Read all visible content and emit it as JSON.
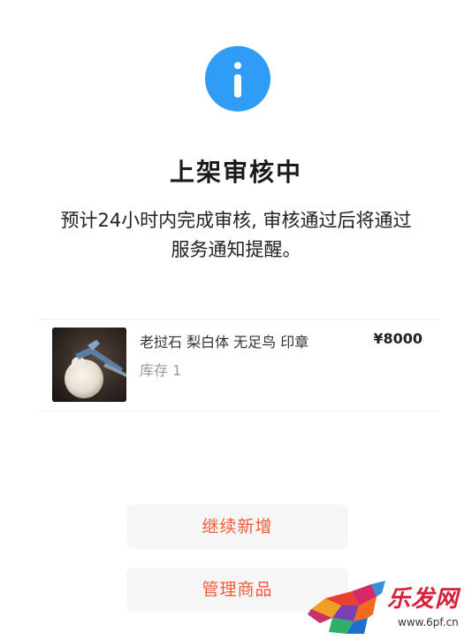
{
  "status": {
    "icon": "info-icon",
    "accent_color": "#2f9cf6",
    "title": "上架审核中",
    "message_line1": "预计24小时内完成审核, 审核通过后将通过",
    "message_line2": "服务通知提醒。"
  },
  "product": {
    "thumbnail": "product-photo",
    "name": "老挝石 梨白体 无足鸟 印章",
    "stock": "库存 1",
    "price": "¥8000"
  },
  "actions": {
    "continue_label": "继续新增",
    "manage_label": "管理商品",
    "accent_color": "#f15a3c"
  },
  "watermark": {
    "brand": "乐发网",
    "url": "www.6pf.cn"
  }
}
